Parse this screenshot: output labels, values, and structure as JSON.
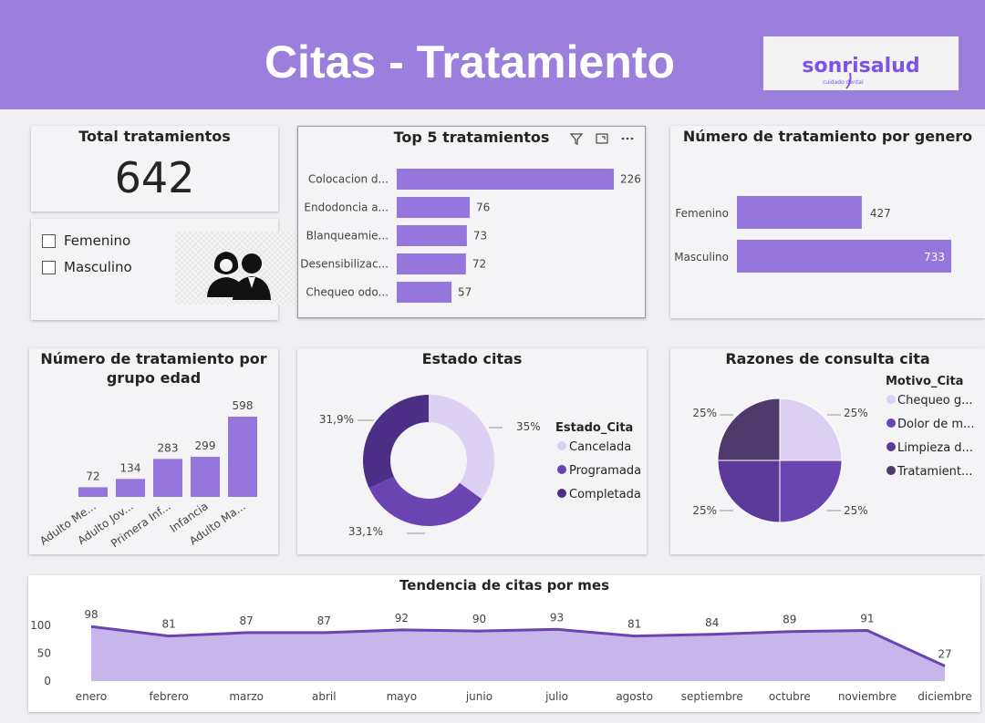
{
  "header": {
    "title": "Citas - Tratamiento",
    "logo_text": "sonrisalud",
    "logo_sub": "cuidado dental"
  },
  "kpi": {
    "title": "Total tratamientos",
    "value": "642"
  },
  "slicer": {
    "items": [
      "Femenino",
      "Masculino"
    ]
  },
  "gender_image": {
    "icon": "people-icon"
  },
  "colors": {
    "accent": "#9b7fdc",
    "bar": "#9576dd",
    "dark_purple": "#4b2f86",
    "light_purple": "#ddd1f3",
    "mid_purple": "#6a44b1"
  },
  "chart_data": [
    {
      "id": "top5",
      "type": "bar",
      "orientation": "horizontal",
      "title": "Top 5 tratamientos",
      "categories": [
        "Colocacion d...",
        "Endodoncia a...",
        "Blanqueamie...",
        "Desensibilizac...",
        "Chequeo odo..."
      ],
      "values": [
        226,
        76,
        73,
        72,
        57
      ]
    },
    {
      "id": "gender",
      "type": "bar",
      "orientation": "horizontal",
      "title": "Número de tratamiento por genero",
      "categories": [
        "Femenino",
        "Masculino"
      ],
      "values": [
        427,
        733
      ]
    },
    {
      "id": "age",
      "type": "bar",
      "title": "Número de tratamiento por grupo edad",
      "title_lines": [
        "Número de tratamiento por",
        "grupo edad"
      ],
      "categories": [
        "Adulto Me...",
        "Adulto Jov...",
        "Primera Inf...",
        "Infancia",
        "Adulto Ma..."
      ],
      "values": [
        72,
        134,
        283,
        299,
        598
      ]
    },
    {
      "id": "estado",
      "type": "pie",
      "variant": "donut",
      "title": "Estado citas",
      "legend_title": "Estado_Cita",
      "categories": [
        "Cancelada",
        "Programada",
        "Completada"
      ],
      "values": [
        35,
        33.1,
        31.9
      ],
      "labels": [
        "35%",
        "33,1%",
        "31,9%"
      ],
      "colors": [
        "#ddd1f3",
        "#6a44b1",
        "#4b2f86"
      ]
    },
    {
      "id": "razones",
      "type": "pie",
      "title": "Razones de consulta cita",
      "legend_title": "Motivo_Cita",
      "categories": [
        "Chequeo g...",
        "Dolor de m...",
        "Limpieza d...",
        "Tratamient..."
      ],
      "values": [
        25,
        25,
        25,
        25
      ],
      "labels": [
        "25%",
        "25%",
        "25%",
        "25%"
      ],
      "colors": [
        "#ddd1f3",
        "#6a44b1",
        "#5b3a9a",
        "#4d3a6b"
      ]
    },
    {
      "id": "tendencia",
      "type": "area",
      "title": "Tendencia de citas por mes",
      "categories": [
        "enero",
        "febrero",
        "marzo",
        "abril",
        "mayo",
        "junio",
        "julio",
        "agosto",
        "septiembre",
        "octubre",
        "noviembre",
        "diciembre"
      ],
      "values": [
        98,
        81,
        87,
        87,
        92,
        90,
        93,
        81,
        84,
        89,
        91,
        27
      ],
      "yticks": [
        0,
        50,
        100
      ],
      "ylim": [
        0,
        100
      ]
    }
  ]
}
